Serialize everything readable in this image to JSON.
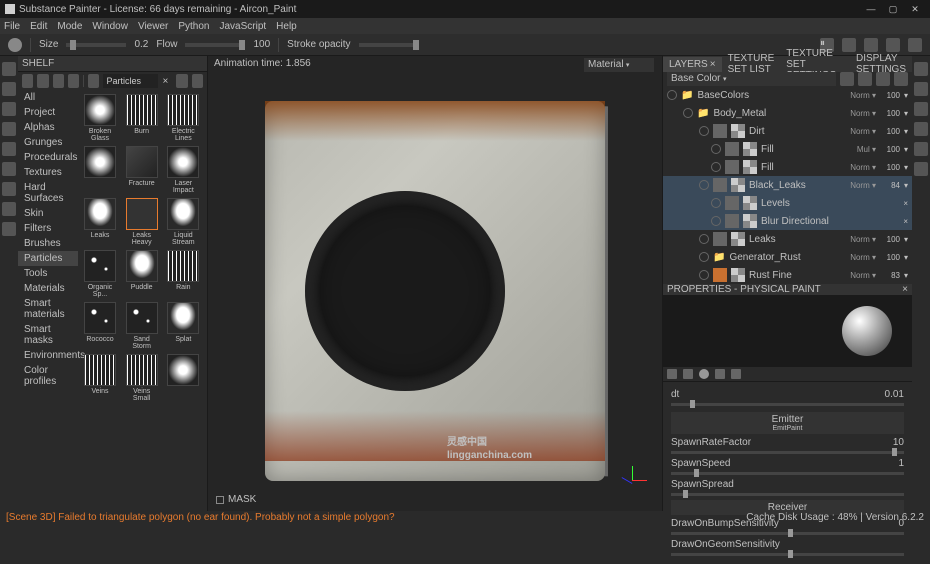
{
  "titlebar": {
    "text": "Substance Painter - License: 66 days remaining - Aircon_Paint"
  },
  "menu": [
    "File",
    "Edit",
    "Mode",
    "Window",
    "Viewer",
    "Python",
    "JavaScript",
    "Help"
  ],
  "toolbar": {
    "size_label": "Size",
    "size_val": "0.2",
    "flow_label": "Flow",
    "flow_val": "100",
    "stroke_label": "Stroke opacity"
  },
  "shelf": {
    "title": "SHELF",
    "search": "Particles",
    "cats": [
      "All",
      "Project",
      "Alphas",
      "Grunges",
      "Procedurals",
      "Textures",
      "Hard Surfaces",
      "Skin",
      "Filters",
      "Brushes",
      "Particles",
      "Tools",
      "Materials",
      "Smart materials",
      "Smart masks",
      "Environments",
      "Color profiles"
    ],
    "selected_cat": "Particles",
    "thumbs": [
      {
        "label": "Broken Glass"
      },
      {
        "label": "Burn"
      },
      {
        "label": "Electric Lines"
      },
      {
        "label": ""
      },
      {
        "label": "Fracture"
      },
      {
        "label": "Laser Impact"
      },
      {
        "label": "Leaks"
      },
      {
        "label": "Leaks Heavy"
      },
      {
        "label": "Liquid Stream"
      },
      {
        "label": "Organic Sp..."
      },
      {
        "label": "Puddle"
      },
      {
        "label": "Rain"
      },
      {
        "label": "Rococco"
      },
      {
        "label": "Sand Storm"
      },
      {
        "label": "Splat"
      },
      {
        "label": "Veins"
      },
      {
        "label": "Veins Small"
      },
      {
        "label": ""
      }
    ]
  },
  "viewport": {
    "anim": "Animation time: 1.856",
    "dropdown": "Material",
    "mask": "MASK"
  },
  "tabs": [
    "LAYERS",
    "TEXTURE SET LIST",
    "TEXTURE SET SETTINGS",
    "DISPLAY SETTINGS"
  ],
  "channel": "Base Color",
  "layers": [
    {
      "name": "BaseColors",
      "type": "folder",
      "blend": "Norm",
      "op": "100",
      "indent": 0
    },
    {
      "name": "Body_Metal",
      "type": "folder",
      "blend": "Norm",
      "op": "100",
      "indent": 1
    },
    {
      "name": "Dirt",
      "type": "layer",
      "blend": "Norm",
      "op": "100",
      "indent": 2
    },
    {
      "name": "Fill",
      "type": "fill",
      "blend": "Mul",
      "op": "100",
      "indent": 3
    },
    {
      "name": "Fill",
      "type": "fill",
      "blend": "Norm",
      "op": "100",
      "indent": 3
    },
    {
      "name": "Black_Leaks",
      "type": "layer",
      "blend": "Norm",
      "op": "84",
      "indent": 2,
      "sel": true
    },
    {
      "name": "Levels",
      "type": "fx",
      "blend": "",
      "op": "",
      "indent": 3,
      "sel": true
    },
    {
      "name": "Blur Directional",
      "type": "fx",
      "blend": "",
      "op": "",
      "indent": 3,
      "sel": true
    },
    {
      "name": "Leaks",
      "type": "layer",
      "blend": "Norm",
      "op": "100",
      "indent": 2
    },
    {
      "name": "Generator_Rust",
      "type": "folder",
      "blend": "Norm",
      "op": "100",
      "indent": 2
    },
    {
      "name": "Rust Fine",
      "type": "layer",
      "blend": "Norm",
      "op": "83",
      "indent": 2
    }
  ],
  "props": {
    "title": "PROPERTIES - PHYSICAL PAINT",
    "emitter": "Emitter",
    "emitter_sub": "EmitPaint",
    "params": [
      {
        "label": "dt",
        "val": "0.01",
        "pos": 8
      },
      {
        "label": "SpawnRateFactor",
        "val": "10",
        "pos": 95
      },
      {
        "label": "SpawnSpeed",
        "val": "1",
        "pos": 10
      },
      {
        "label": "SpawnSpread",
        "val": "",
        "pos": 5
      },
      {
        "label": "Receiver",
        "val": "",
        "pos": 0,
        "header": true
      },
      {
        "label": "DrawOnBumpSensitivity",
        "val": "0",
        "pos": 50
      },
      {
        "label": "DrawOnGeomSensitivity",
        "val": "",
        "pos": 50
      }
    ]
  },
  "status": {
    "err": "[Scene 3D] Failed to triangulate polygon (no ear found). Probably not a simple polygon?",
    "right": "Cache Disk Usage : 48% | Version 6.2.2"
  },
  "watermark": "灵感中国"
}
